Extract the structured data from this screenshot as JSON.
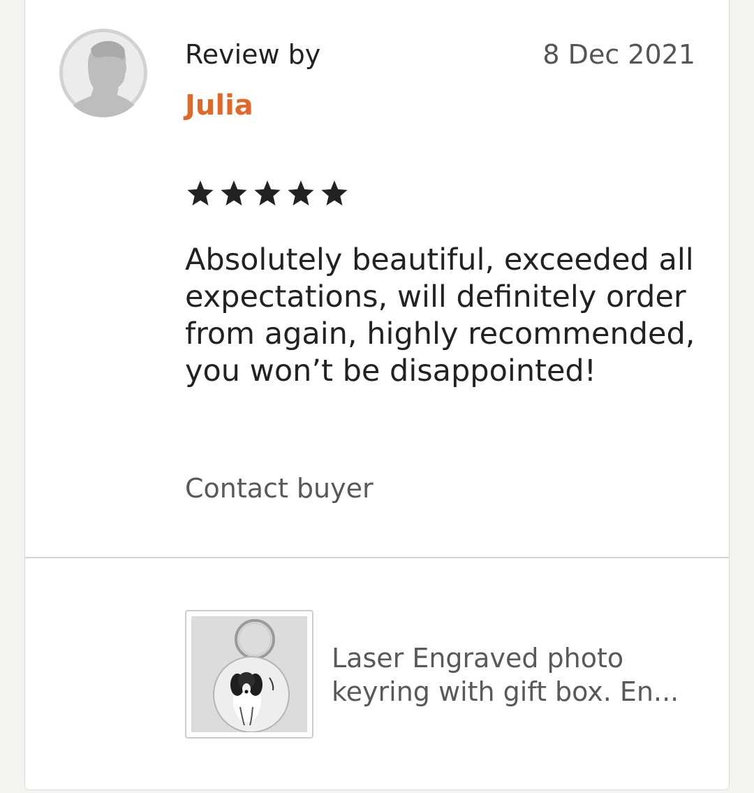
{
  "review": {
    "by_label": "Review by",
    "reviewer_name": "Julia",
    "date": "8 Dec 2021",
    "rating": 5,
    "rating_max": 5,
    "text": "Absolutely beautiful, exceeded all expectations, will definitely order from again, highly recommended, you won’t be disappointed!",
    "contact_label": "Contact buyer"
  },
  "listing": {
    "title": "Laser Engraved photo keyring with gift box. En..."
  },
  "colors": {
    "reviewer_name": "#e0692a",
    "star": "#222222",
    "background": "#f4f3ef",
    "card": "#ffffff"
  },
  "icons": {
    "avatar": "default-user-avatar-icon",
    "star": "star-icon"
  }
}
